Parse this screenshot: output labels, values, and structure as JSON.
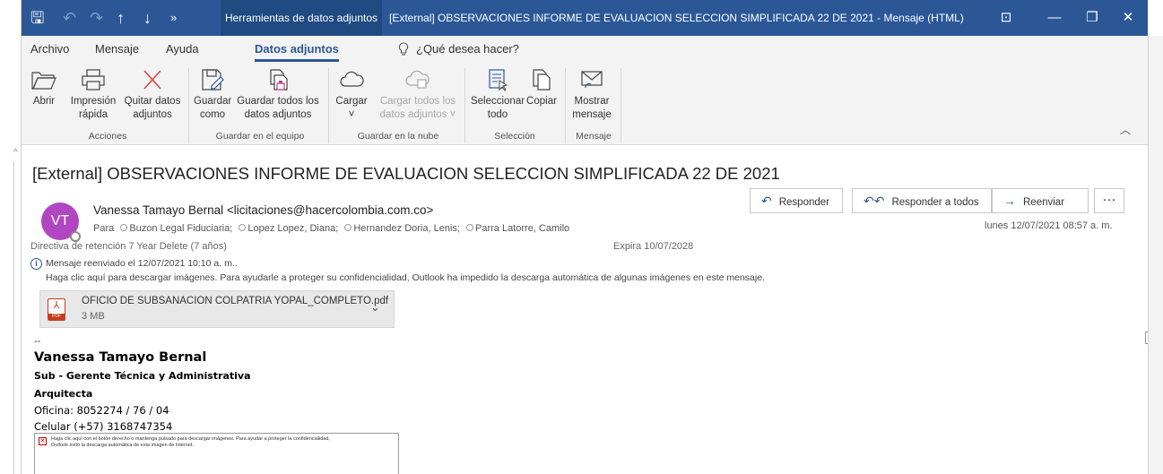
{
  "titlebar": {
    "context_tab": "Herramientas de datos adjuntos",
    "window_title": "[External] OBSERVACIONES INFORME DE EVALUACION SELECCION SIMPLIFICADA 22 DE 2021  -  Mensaje (HTML)",
    "quick_access": {
      "save": "🖫",
      "undo": "↶",
      "redo": "↷",
      "up": "↑",
      "down": "↓",
      "more": "»"
    },
    "window_buttons": {
      "ribbon_options": "⊡",
      "minimize": "—",
      "restore": "❐",
      "close": "✕"
    }
  },
  "ribbon_tabs": [
    "Archivo",
    "Mensaje",
    "Ayuda",
    "Datos adjuntos"
  ],
  "tell_me": {
    "icon": "lightbulb-icon",
    "placeholder": "¿Qué desea hacer?"
  },
  "ribbon": {
    "buttons": [
      {
        "id": "abrir",
        "label1": "Abrir",
        "label2": ""
      },
      {
        "id": "impresion",
        "label1": "Impresión",
        "label2": "rápida"
      },
      {
        "id": "quitar",
        "label1": "Quitar datos",
        "label2": "adjuntos"
      },
      {
        "id": "guardar-como",
        "label1": "Guardar",
        "label2": "como"
      },
      {
        "id": "guardar-todos",
        "label1": "Guardar todos los",
        "label2": "datos adjuntos"
      },
      {
        "id": "cargar",
        "label1": "Cargar",
        "label2": "˅"
      },
      {
        "id": "cargar-todos",
        "label1": "Cargar todos los",
        "label2": "datos adjuntos ˅"
      },
      {
        "id": "seleccionar",
        "label1": "Seleccionar",
        "label2": "todo"
      },
      {
        "id": "copiar",
        "label1": "Copiar",
        "label2": ""
      },
      {
        "id": "mostrar",
        "label1": "Mostrar",
        "label2": "mensaje"
      }
    ],
    "groups": [
      "Acciones",
      "Guardar en el equipo",
      "Guardar en la nube",
      "Selección",
      "Mensaje"
    ]
  },
  "message": {
    "subject": "[External] OBSERVACIONES INFORME DE EVALUACION SELECCION SIMPLIFICADA 22 DE 2021",
    "avatar_initials": "VT",
    "sender": "Vanessa Tamayo Bernal <licitaciones@hacercolombia.com.co>",
    "to_label": "Para",
    "recipients": [
      "Buzon Legal Fiduciaria;",
      "Lopez Lopez, Diana;",
      "Hernandez Doria, Lenis;",
      "Parra Latorre, Camilo"
    ],
    "actions": {
      "reply": "Responder",
      "reply_all": "Responder a todos",
      "forward": "Reenviar",
      "more": "···"
    },
    "datetime": "lunes 12/07/2021 08:57 a. m.",
    "retention": "Directiva de retención   7 Year Delete (7 años)",
    "expires": "Expira   10/07/2028",
    "forwarded_note": "Mensaje reenviado el 12/07/2021 10:10 a. m..",
    "image_warning": "Haga clic aquí para descargar imágenes. Para ayudarle a proteger su confidencialidad, Outlook ha impedido la descarga automática de algunas imágenes en este mensaje."
  },
  "attachment": {
    "name": "OFICIO DE SUBSANACION COLPATRIA YOPAL_COMPLETO.pdf",
    "size": "3 MB",
    "type_label": "PDF"
  },
  "signature": {
    "dash": "--",
    "name": "Vanessa Tamayo Bernal",
    "role": "Sub - Gerente Técnica y Administrativa",
    "title": "Arquitecta",
    "office": "Oficina: 8052274 / 76 / 04",
    "cell": "Celular (+57) 3168747354",
    "blocked_line1": "Haga clic aquí con el botón derecho o mantenga pulsado para descargar imágenes. Para ayudar a proteger la confidencialidad,",
    "blocked_line2": "Outlook evitó la descarga automática de esta imagen de Internet."
  },
  "colors": {
    "titlebar": "#2b5797",
    "accent": "#2b579a",
    "avatar": "#b146c2",
    "ribbon_bg": "#f3f3f3"
  }
}
